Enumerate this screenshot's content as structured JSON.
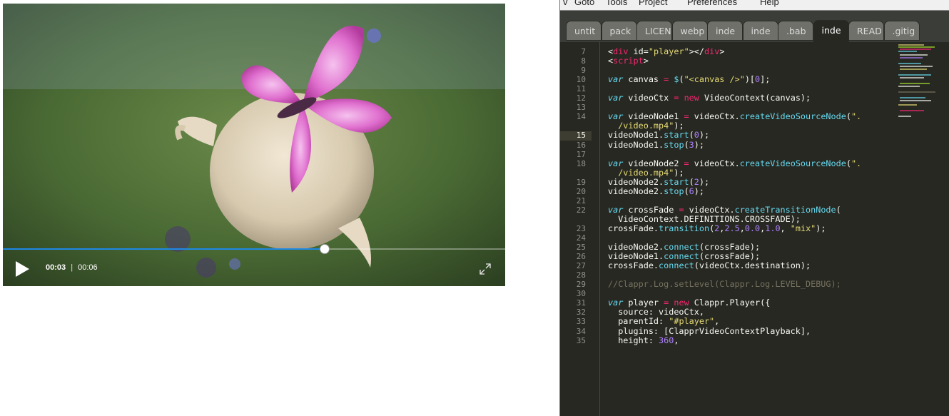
{
  "player": {
    "current_time": "00:03",
    "separator": "|",
    "duration": "00:06",
    "progress_fraction": 0.64
  },
  "editor": {
    "menu": [
      "v",
      "Goto",
      "Tools",
      "Project",
      "Preferences",
      "Help"
    ],
    "tabs": [
      "untit",
      "pack",
      "LICEN",
      "webp",
      "inde",
      "inde",
      ".bab",
      "inde",
      "READ",
      ".gitig"
    ],
    "active_tab_index": 7,
    "current_line": 15,
    "lines": [
      {
        "n": "7",
        "tokens": [
          [
            "tag",
            "<"
          ],
          [
            "o",
            "div"
          ],
          [
            "p",
            " "
          ],
          [
            "a",
            "id"
          ],
          [
            "p",
            "="
          ],
          [
            "s",
            "\"player\""
          ],
          [
            "p",
            "></"
          ],
          [
            "o",
            "div"
          ],
          [
            "p",
            ">"
          ]
        ]
      },
      {
        "n": "8",
        "tokens": [
          [
            "p",
            "<"
          ],
          [
            "o",
            "script"
          ],
          [
            "p",
            ">"
          ]
        ]
      },
      {
        "n": "9",
        "tokens": []
      },
      {
        "n": "10",
        "tokens": [
          [
            "k",
            "var"
          ],
          [
            "p",
            " canvas "
          ],
          [
            "o",
            "="
          ],
          [
            "p",
            " "
          ],
          [
            "f",
            "$"
          ],
          [
            "p",
            "("
          ],
          [
            "s",
            "\"<canvas />\""
          ],
          [
            "p",
            ")["
          ],
          [
            "n",
            "0"
          ],
          [
            "p",
            "];"
          ]
        ]
      },
      {
        "n": "11",
        "tokens": []
      },
      {
        "n": "12",
        "tokens": [
          [
            "k",
            "var"
          ],
          [
            "p",
            " videoCtx "
          ],
          [
            "o",
            "="
          ],
          [
            "p",
            " "
          ],
          [
            "o",
            "new"
          ],
          [
            "p",
            " VideoContext(canvas);"
          ]
        ]
      },
      {
        "n": "13",
        "tokens": []
      },
      {
        "n": "14",
        "tokens": [
          [
            "k",
            "var"
          ],
          [
            "p",
            " videoNode1 "
          ],
          [
            "o",
            "="
          ],
          [
            "p",
            " videoCtx."
          ],
          [
            "f",
            "createVideoSourceNode"
          ],
          [
            "p",
            "("
          ],
          [
            "s",
            "\"."
          ]
        ]
      },
      {
        "n": "",
        "tokens": [
          [
            "s",
            "  /video.mp4\""
          ],
          [
            "p",
            ");"
          ]
        ]
      },
      {
        "n": "15",
        "tokens": [
          [
            "p",
            "videoNode1."
          ],
          [
            "f",
            "start"
          ],
          [
            "p",
            "("
          ],
          [
            "n",
            "0"
          ],
          [
            "p",
            ");"
          ]
        ]
      },
      {
        "n": "16",
        "tokens": [
          [
            "p",
            "videoNode1."
          ],
          [
            "f",
            "stop"
          ],
          [
            "p",
            "("
          ],
          [
            "n",
            "3"
          ],
          [
            "p",
            ");"
          ]
        ]
      },
      {
        "n": "17",
        "tokens": []
      },
      {
        "n": "18",
        "tokens": [
          [
            "k",
            "var"
          ],
          [
            "p",
            " videoNode2 "
          ],
          [
            "o",
            "="
          ],
          [
            "p",
            " videoCtx."
          ],
          [
            "f",
            "createVideoSourceNode"
          ],
          [
            "p",
            "("
          ],
          [
            "s",
            "\"."
          ]
        ]
      },
      {
        "n": "",
        "tokens": [
          [
            "s",
            "  /video.mp4\""
          ],
          [
            "p",
            ");"
          ]
        ]
      },
      {
        "n": "19",
        "tokens": [
          [
            "p",
            "videoNode2."
          ],
          [
            "f",
            "start"
          ],
          [
            "p",
            "("
          ],
          [
            "n",
            "2"
          ],
          [
            "p",
            ");"
          ]
        ]
      },
      {
        "n": "20",
        "tokens": [
          [
            "p",
            "videoNode2."
          ],
          [
            "f",
            "stop"
          ],
          [
            "p",
            "("
          ],
          [
            "n",
            "6"
          ],
          [
            "p",
            ");"
          ]
        ]
      },
      {
        "n": "21",
        "tokens": []
      },
      {
        "n": "22",
        "tokens": [
          [
            "k",
            "var"
          ],
          [
            "p",
            " crossFade "
          ],
          [
            "o",
            "="
          ],
          [
            "p",
            " videoCtx."
          ],
          [
            "f",
            "createTransitionNode"
          ],
          [
            "p",
            "("
          ]
        ]
      },
      {
        "n": "",
        "tokens": [
          [
            "p",
            "  VideoContext.DEFINITIONS.CROSSFADE);"
          ]
        ]
      },
      {
        "n": "23",
        "tokens": [
          [
            "p",
            "crossFade."
          ],
          [
            "f",
            "transition"
          ],
          [
            "p",
            "("
          ],
          [
            "n",
            "2"
          ],
          [
            "p",
            ","
          ],
          [
            "n",
            "2.5"
          ],
          [
            "p",
            ","
          ],
          [
            "n",
            "0.0"
          ],
          [
            "p",
            ","
          ],
          [
            "n",
            "1.0"
          ],
          [
            "p",
            ", "
          ],
          [
            "s",
            "\"mix\""
          ],
          [
            "p",
            ");"
          ]
        ]
      },
      {
        "n": "24",
        "tokens": []
      },
      {
        "n": "25",
        "tokens": [
          [
            "p",
            "videoNode2."
          ],
          [
            "f",
            "connect"
          ],
          [
            "p",
            "(crossFade);"
          ]
        ]
      },
      {
        "n": "26",
        "tokens": [
          [
            "p",
            "videoNode1."
          ],
          [
            "f",
            "connect"
          ],
          [
            "p",
            "(crossFade);"
          ]
        ]
      },
      {
        "n": "27",
        "tokens": [
          [
            "p",
            "crossFade."
          ],
          [
            "f",
            "connect"
          ],
          [
            "p",
            "(videoCtx.destination);"
          ]
        ]
      },
      {
        "n": "28",
        "tokens": []
      },
      {
        "n": "29",
        "tokens": [
          [
            "c",
            "//Clappr.Log.setLevel(Clappr.Log.LEVEL_DEBUG);"
          ]
        ]
      },
      {
        "n": "30",
        "tokens": []
      },
      {
        "n": "31",
        "tokens": [
          [
            "k",
            "var"
          ],
          [
            "p",
            " player "
          ],
          [
            "o",
            "="
          ],
          [
            "p",
            " "
          ],
          [
            "o",
            "new"
          ],
          [
            "p",
            " Clappr.Player({"
          ]
        ]
      },
      {
        "n": "32",
        "tokens": [
          [
            "p",
            "  source: videoCtx,"
          ]
        ]
      },
      {
        "n": "33",
        "tokens": [
          [
            "p",
            "  parentId: "
          ],
          [
            "s",
            "\"#player\""
          ],
          [
            "p",
            ","
          ]
        ]
      },
      {
        "n": "34",
        "tokens": [
          [
            "p",
            "  plugins: [ClapprVideoContextPlayback],"
          ]
        ]
      },
      {
        "n": "35",
        "tokens": [
          [
            "p",
            "  height: "
          ],
          [
            "n",
            "360"
          ],
          [
            "p",
            ","
          ]
        ]
      }
    ]
  }
}
